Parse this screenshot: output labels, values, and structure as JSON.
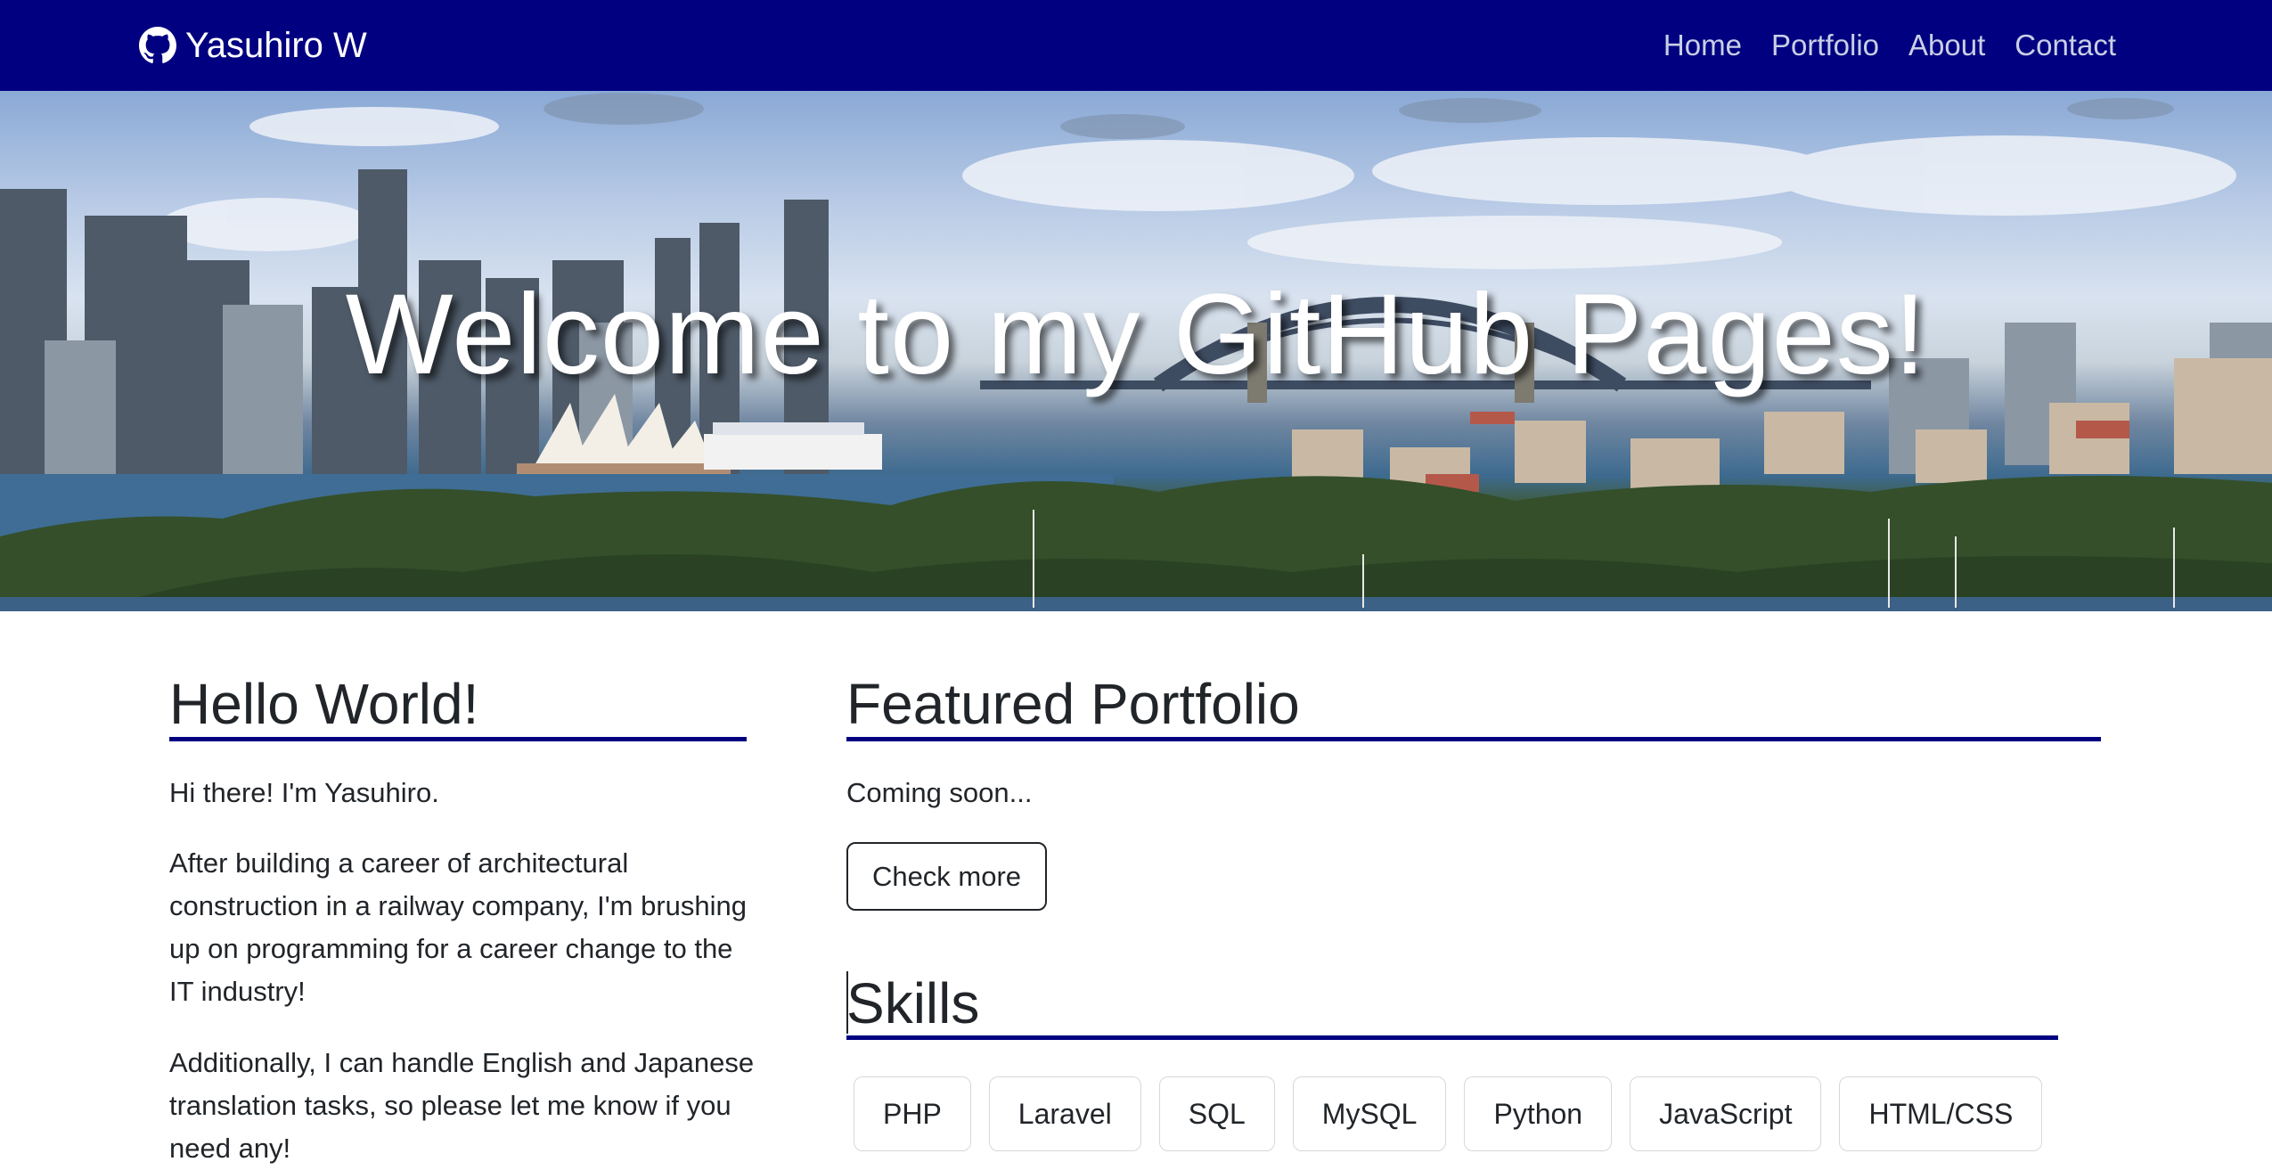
{
  "navbar": {
    "brand": "Yasuhiro W",
    "brand_icon": "github-icon",
    "links": [
      "Home",
      "Portfolio",
      "About",
      "Contact"
    ]
  },
  "hero": {
    "heading": "Welcome to my GitHub Pages!"
  },
  "intro": {
    "title": "Hello World!",
    "paragraphs": [
      "Hi there! I'm Yasuhiro.",
      "After building a career of architectural construction in a railway company, I'm brushing up on programming for a career change to the IT industry!",
      "Additionally, I can handle English and Japanese translation tasks, so please let me know if you need any!"
    ]
  },
  "portfolio": {
    "title": "Featured Portfolio",
    "status": "Coming soon...",
    "button": "Check more"
  },
  "skills": {
    "title": "Skills",
    "items": [
      "PHP",
      "Laravel",
      "SQL",
      "MySQL",
      "Python",
      "JavaScript",
      "HTML/CSS"
    ]
  },
  "colors": {
    "accent": "#000080",
    "nav_link": "#c9cfe6",
    "text": "#212529"
  }
}
